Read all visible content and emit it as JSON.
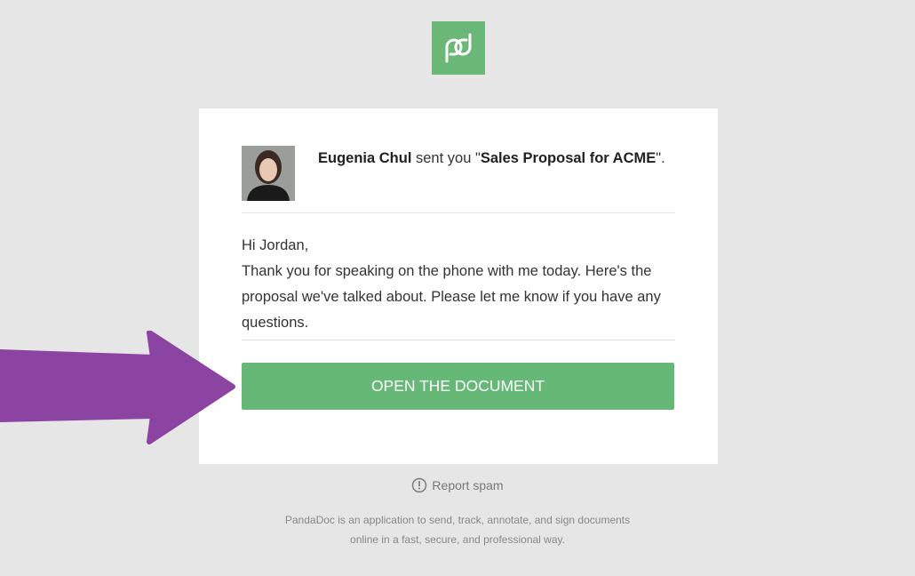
{
  "brand": {
    "logo_icon": "pandadoc-logo-icon",
    "accent_color": "#6bb777"
  },
  "email": {
    "sender_name": "Eugenia Chul",
    "sent_text": " sent you \"",
    "document_title": "Sales Proposal for ACME",
    "end_text": "\".",
    "greeting": "Hi Jordan,",
    "body": "Thank you for speaking on the phone with me today. Here's the proposal we've talked about. Please let me know if you have any questions.",
    "button_label": "OPEN THE DOCUMENT",
    "button_color": "#66b877"
  },
  "report_spam": {
    "icon": "exclamation-circle-icon",
    "label": "Report spam"
  },
  "footer": {
    "line1": "PandaDoc is an application to send, track, annotate, and sign documents",
    "line2": "online in a fast, secure, and professional way."
  },
  "annotation": {
    "arrow_icon": "arrow-right-icon",
    "arrow_color": "#8b44a2"
  }
}
